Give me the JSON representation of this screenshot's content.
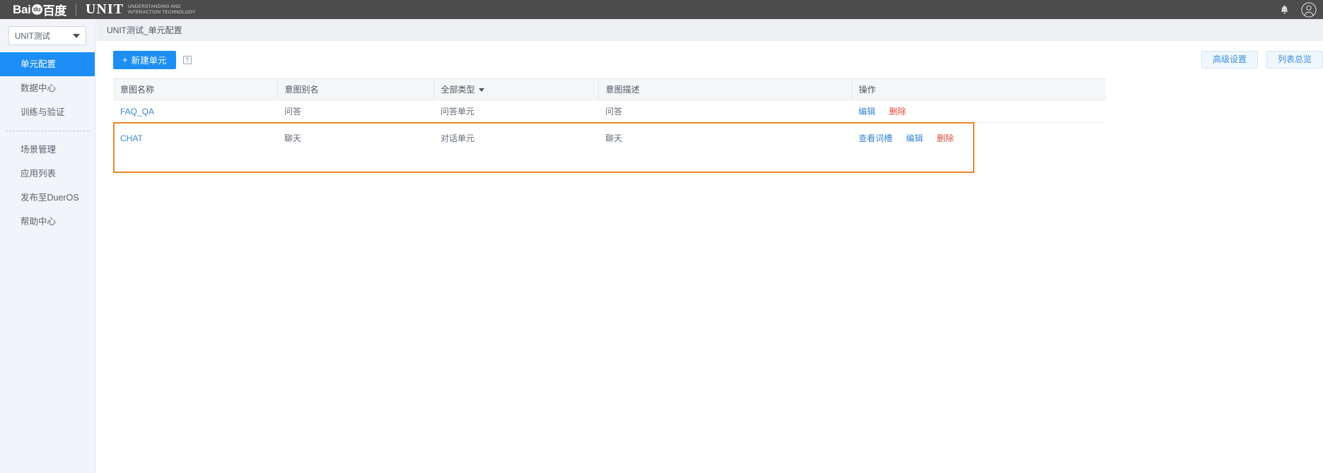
{
  "topbar": {
    "baidu_logo_text": "Bai",
    "baidu_paw": "du",
    "baidu_cn": "百度",
    "unit_word": "UNIT",
    "tagline_line1": "UNDERSTANDING AND",
    "tagline_line2": "INTERACTION TECHNOLOGY",
    "bell_icon": "bell-icon",
    "avatar_icon": "user-avatar-icon"
  },
  "sidebar": {
    "project_selector_value": "UNIT测试",
    "items": [
      {
        "label": "单元配置",
        "active": true
      },
      {
        "label": "数据中心",
        "active": false
      },
      {
        "label": "训练与验证",
        "active": false
      },
      {
        "label": "场景管理",
        "active": false
      },
      {
        "label": "应用列表",
        "active": false
      },
      {
        "label": "发布至DuerOS",
        "active": false
      },
      {
        "label": "帮助中心",
        "active": false
      }
    ]
  },
  "breadcrumb": "UNIT测试_单元配置",
  "toolbar": {
    "new_unit_label": "新建单元",
    "plus_glyph": "+",
    "help_glyph": "?",
    "advanced_settings_label": "高级设置",
    "list_overview_label": "列表总览"
  },
  "table": {
    "columns": [
      "意图名称",
      "意图别名",
      "全部类型",
      "意图描述",
      "操作"
    ],
    "type_column_has_filter": true,
    "rows": [
      {
        "name": "FAQ_QA",
        "alias": "问答",
        "type": "问答单元",
        "description": "问答",
        "ops": [
          {
            "label": "编辑",
            "kind": "normal"
          },
          {
            "label": "删除",
            "kind": "danger"
          }
        ]
      },
      {
        "name": "CHAT",
        "alias": "聊天",
        "type": "对话单元",
        "description": "聊天",
        "ops": [
          {
            "label": "查看词槽",
            "kind": "normal"
          },
          {
            "label": "编辑",
            "kind": "normal"
          },
          {
            "label": "删除",
            "kind": "danger"
          }
        ]
      }
    ]
  },
  "colors": {
    "accent_blue": "#1c8ef5",
    "link_blue": "#3b87d6",
    "danger_red": "#e34a3c",
    "highlight_orange": "#e8872a",
    "topbar_dark": "#4c4c4c",
    "sidebar_bg": "#f2f4f9"
  }
}
